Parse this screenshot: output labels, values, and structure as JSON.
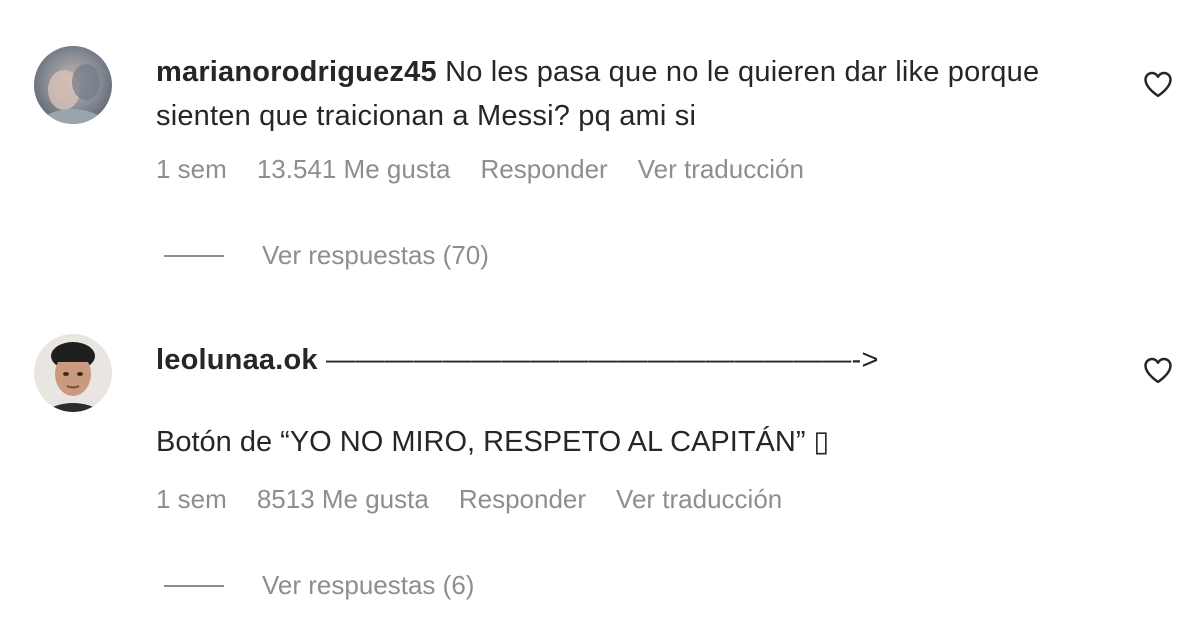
{
  "comments": [
    {
      "username": "marianorodriguez45",
      "text": "No les pasa que no le quieren dar like porque sienten que traicionan a Messi? pq ami si",
      "time": "1 sem",
      "likes": "13.541 Me gusta",
      "reply_label": "Responder",
      "translate_label": "Ver traducción",
      "replies_label": "Ver respuestas (70)"
    },
    {
      "username": "leolunaa.ok",
      "text": "——————————————————->",
      "text_line2": "Botón de “YO NO MIRO, RESPETO AL CAPITÁN” ▯",
      "time": "1 sem",
      "likes": "8513 Me gusta",
      "reply_label": "Responder",
      "translate_label": "Ver traducción",
      "replies_label": "Ver respuestas (6)"
    }
  ],
  "icons": {
    "like": "heart-outline-icon"
  },
  "colors": {
    "text": "#262626",
    "secondary": "#8e8e8e",
    "background": "#ffffff"
  }
}
